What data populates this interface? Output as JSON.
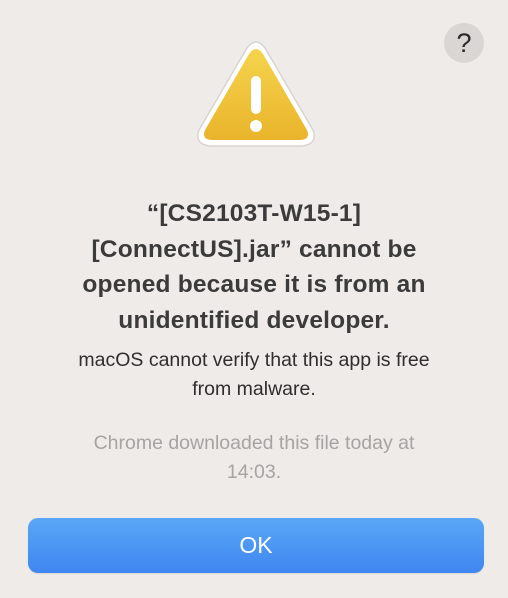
{
  "dialog": {
    "help_label": "?",
    "warning_icon": "warning-triangle-icon",
    "title_lines": [
      "“[CS2103T-W15-1]",
      "[ConnectUS].jar” cannot be",
      "opened because it is from an",
      "unidentified developer."
    ],
    "message_lines": [
      "macOS cannot verify that this app is free",
      "from malware."
    ],
    "info_lines": [
      "Chrome downloaded this file today at",
      "14:03."
    ],
    "ok_label": "OK"
  },
  "colors": {
    "background": "#efebe8",
    "accent": "#3f86f0",
    "warning_yellow": "#f2c43a"
  }
}
